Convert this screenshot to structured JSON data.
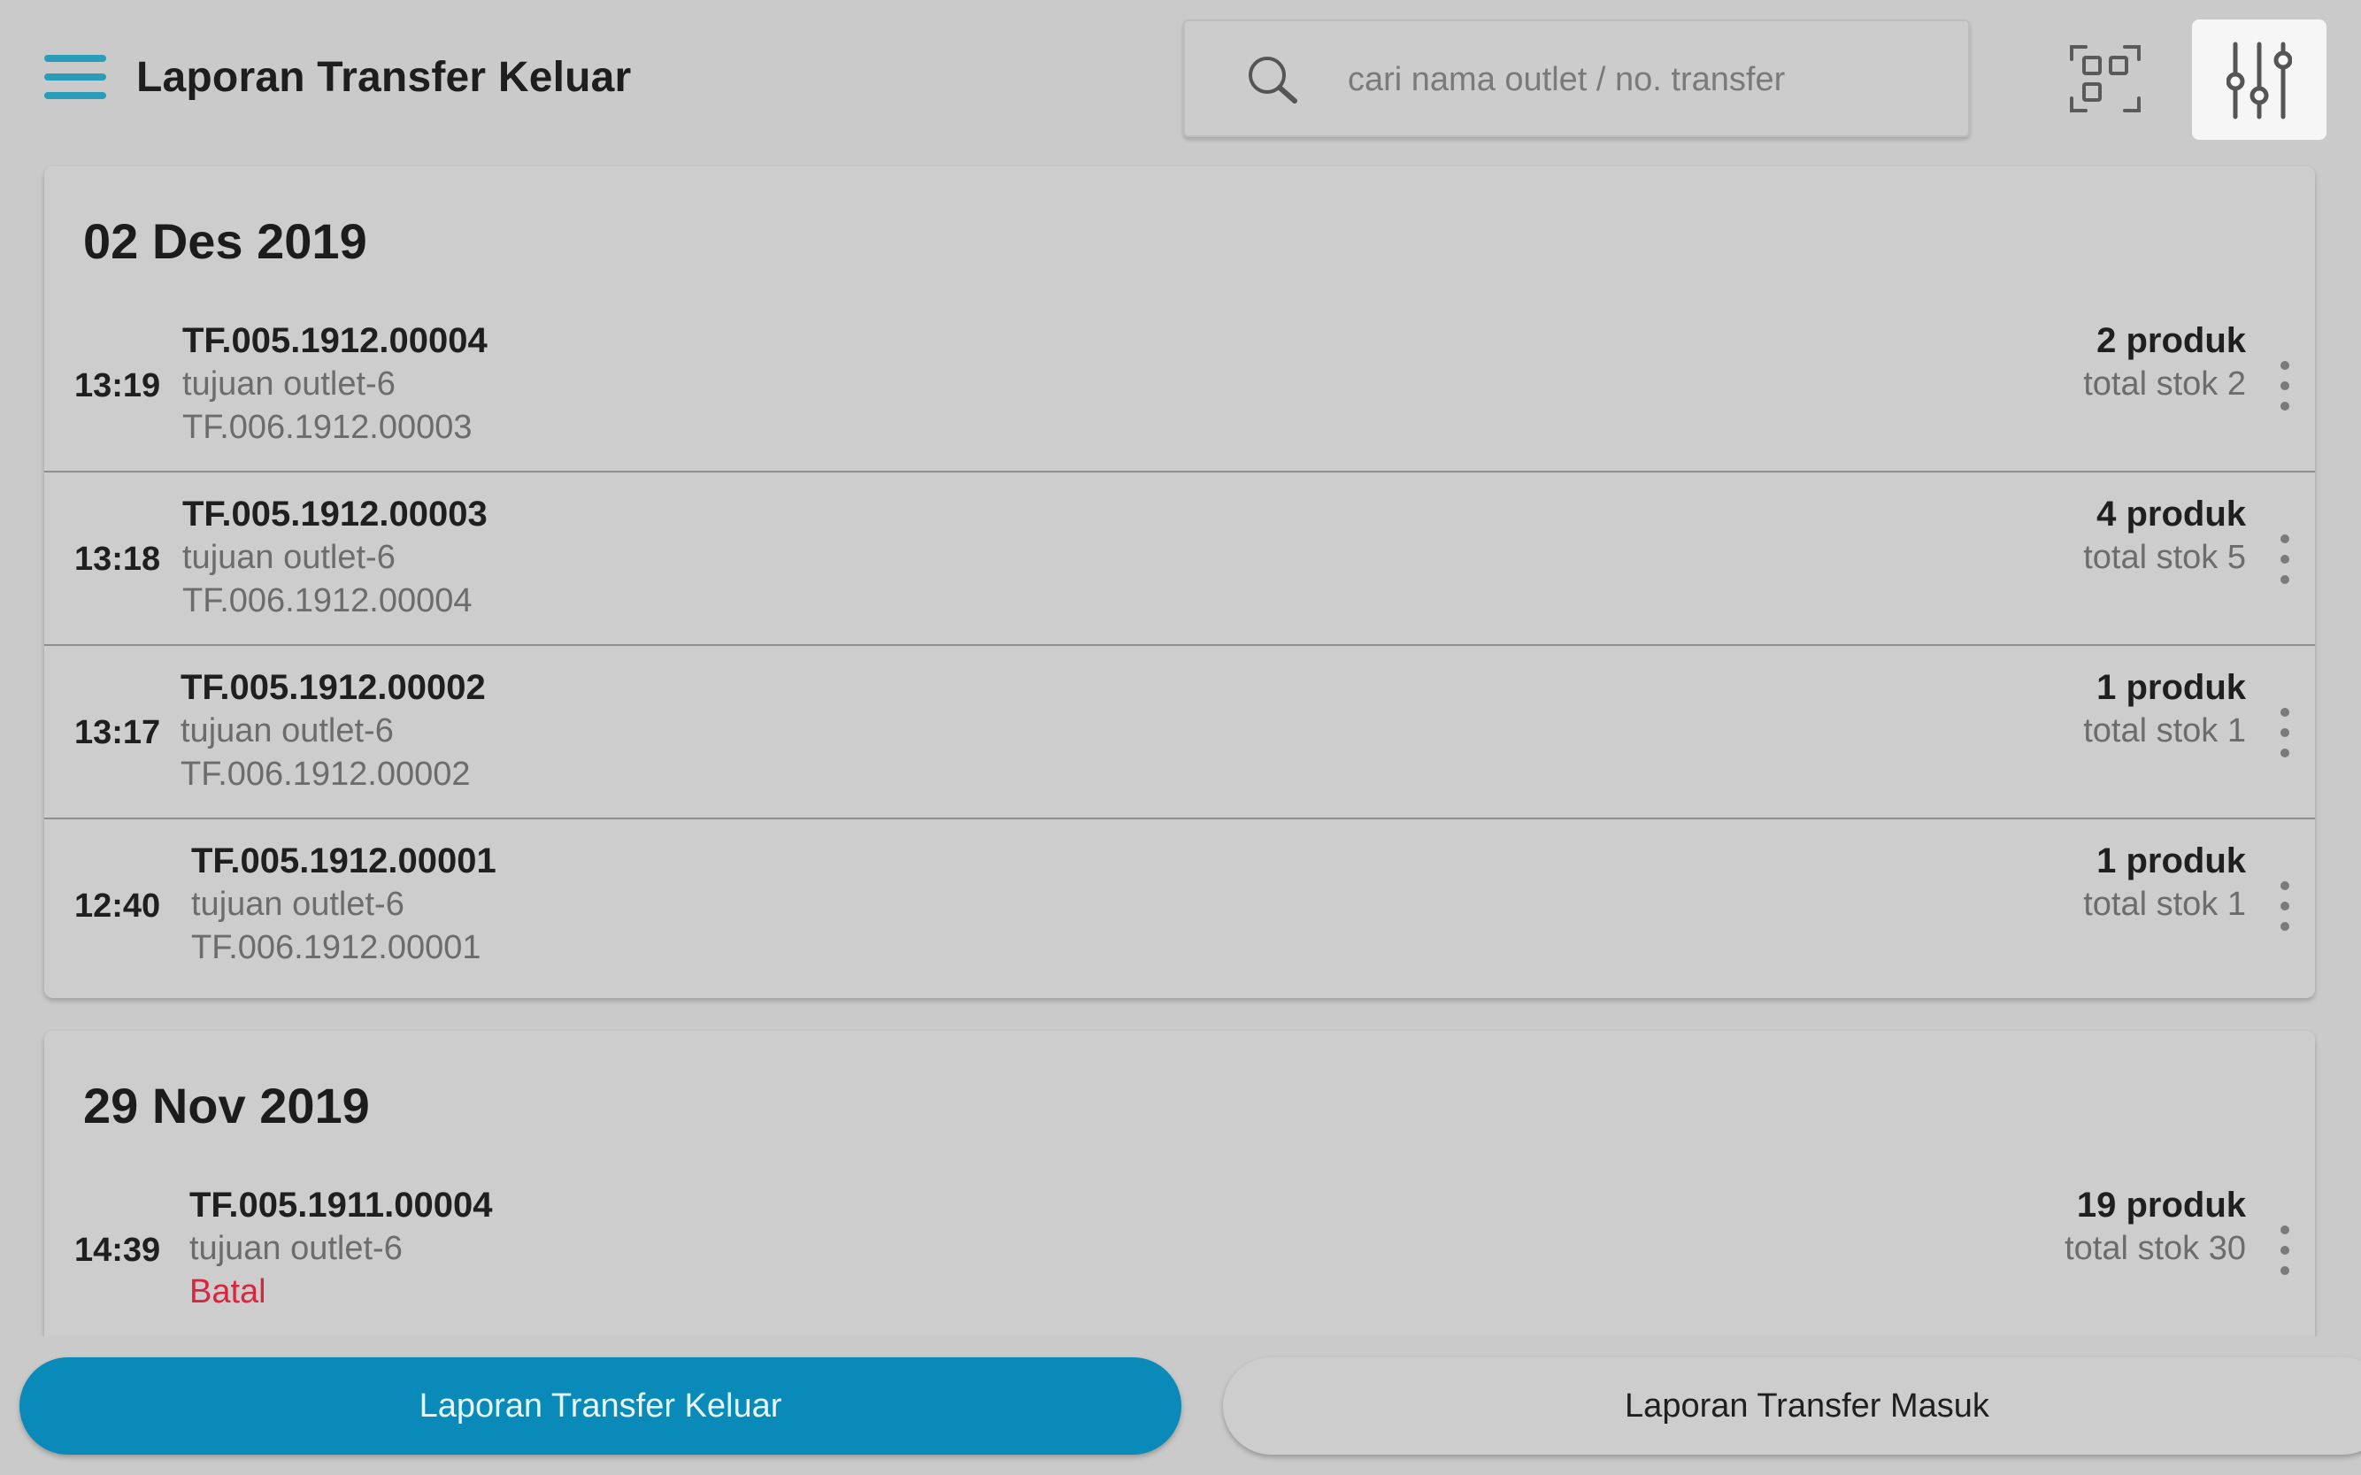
{
  "header": {
    "title": "Laporan Transfer Keluar",
    "search": {
      "placeholder": "cari nama outlet / no. transfer",
      "value": ""
    },
    "icons": {
      "menu": "hamburger-menu-icon",
      "search": "search-icon",
      "scan": "qr-scan-icon",
      "filter": "filter-sliders-icon"
    }
  },
  "groups": [
    {
      "date": "02 Des 2019",
      "items": [
        {
          "time": "13:19",
          "transfer_no": "TF.005.1912.00004",
          "destination": "tujuan outlet-6",
          "reference": "TF.006.1912.00003",
          "products": "2 produk",
          "stock": "total stok 2"
        },
        {
          "time": "13:18",
          "transfer_no": "TF.005.1912.00003",
          "destination": "tujuan outlet-6",
          "reference": "TF.006.1912.00004",
          "products": "4 produk",
          "stock": "total stok 5"
        },
        {
          "time": "13:17",
          "transfer_no": "TF.005.1912.00002",
          "destination": "tujuan outlet-6",
          "reference": "TF.006.1912.00002",
          "products": "1 produk",
          "stock": "total stok 1"
        },
        {
          "time": "12:40",
          "transfer_no": "TF.005.1912.00001",
          "destination": "tujuan outlet-6",
          "reference": "TF.006.1912.00001",
          "products": "1 produk",
          "stock": "total stok 1"
        }
      ]
    },
    {
      "date": "29 Nov 2019",
      "items": [
        {
          "time": "14:39",
          "transfer_no": "TF.005.1911.00004",
          "destination": "tujuan outlet-6",
          "status": "Batal",
          "products": "19 produk",
          "stock": "total stok 30"
        }
      ]
    }
  ],
  "bottom_tabs": {
    "outgoing": "Laporan Transfer Keluar",
    "incoming": "Laporan Transfer Masuk",
    "active": "outgoing"
  },
  "colors": {
    "background": "#cacaca",
    "accent": "#0a8ab8",
    "menu_icon": "#2a9db8",
    "cancel_status": "#d7263d",
    "secondary_text": "#6c6c6c"
  }
}
